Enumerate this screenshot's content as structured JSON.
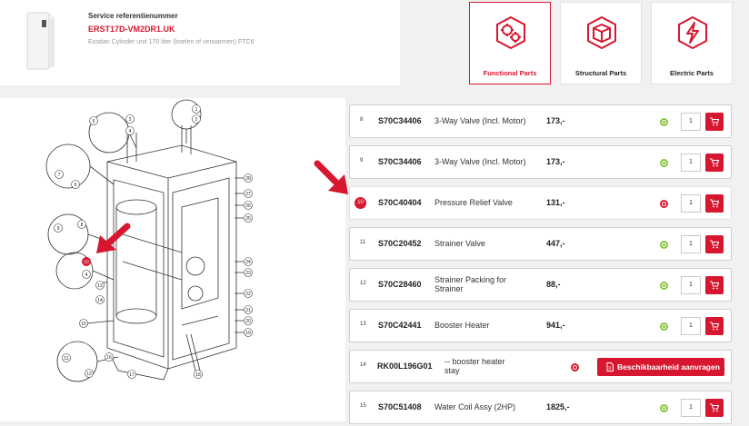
{
  "product": {
    "service_label": "Service referentienummer",
    "service_number": "ERST17D-VM2DR1.UK",
    "description": "Ecodan Cylinder unit 170 liter (koelen of verwarmen) FTC6"
  },
  "categories": [
    {
      "label": "Functional Parts",
      "icon": "gears-icon",
      "active": true
    },
    {
      "label": "Structural Parts",
      "icon": "box-icon",
      "active": false
    },
    {
      "label": "Electric Parts",
      "icon": "lightning-icon",
      "active": false
    }
  ],
  "diagram": {
    "callouts": [
      "1",
      "2",
      "3",
      "4",
      "5",
      "6",
      "7",
      "8",
      "9",
      "10",
      "11",
      "12",
      "13",
      "14",
      "15",
      "16",
      "17",
      "18",
      "19",
      "20",
      "21",
      "22",
      "23",
      "24",
      "25",
      "26",
      "27",
      "28"
    ],
    "highlighted": "10"
  },
  "parts": [
    {
      "num": "8",
      "code": "S70C34406",
      "desc": "3-Way Valve (Incl. Motor)",
      "price": "173,-",
      "status": "green",
      "qty": "1"
    },
    {
      "num": "9",
      "code": "S70C34406",
      "desc": "3-Way Valve (Incl. Motor)",
      "price": "173,-",
      "status": "green",
      "qty": "1"
    },
    {
      "num": "10",
      "code": "S70C40404",
      "desc": "Pressure Relief Valve",
      "price": "131,-",
      "status": "red",
      "qty": "1"
    },
    {
      "num": "11",
      "code": "S70C20452",
      "desc": "Strainer Valve",
      "price": "447,-",
      "status": "green",
      "qty": "1"
    },
    {
      "num": "12",
      "code": "S70C28460",
      "desc": "Strainer Packing for Strainer",
      "price": "88,-",
      "status": "green",
      "qty": "1"
    },
    {
      "num": "13",
      "code": "S70C42441",
      "desc": "Booster Heater",
      "price": "941,-",
      "status": "green",
      "qty": "1"
    },
    {
      "num": "14",
      "code": "RK00L196G01",
      "desc": "-- booster heater stay",
      "price": "",
      "status": "red",
      "button": "Beschikbaarheid aanvragen"
    },
    {
      "num": "15",
      "code": "S70C51408",
      "desc": "Water Coil Assy (2HP)",
      "price": "1825,-",
      "status": "green",
      "qty": "1"
    }
  ],
  "colors": {
    "accent": "#d7172f",
    "available": "#8ac640",
    "unavailable": "#d7172f"
  }
}
